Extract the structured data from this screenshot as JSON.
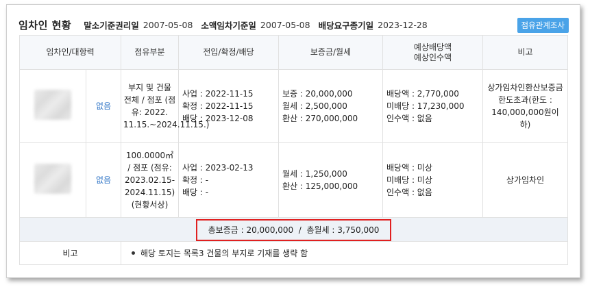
{
  "header": {
    "title": "임차인 현황",
    "items": [
      {
        "label": "말소기준권리일",
        "value": "2007-05-08"
      },
      {
        "label": "소액임차기준일",
        "value": "2007-05-08"
      },
      {
        "label": "배당요구종기일",
        "value": "2023-12-28"
      }
    ],
    "button_label": "점유관계조사"
  },
  "table": {
    "columns": [
      "임차인/대항력",
      "점유부분",
      "전입/확정/배당",
      "보증금/월세",
      "예상배당액\n예상인수액",
      "비고"
    ],
    "rows": [
      {
        "opposing": "없음",
        "occupancy": "부지 및 건물 전체 / 점포 (점유: 2022. 11.15.~2024.11.15.)",
        "dates": [
          "사업 : 2022-11-15",
          "확정 : 2022-11-15",
          "배당 : 2023-12-08"
        ],
        "deposit": [
          "보증 : 20,000,000",
          "월세 : 2,500,000",
          "환산 : 270,000,000"
        ],
        "expected": [
          "배당액 : 2,770,000",
          "미배당 : 17,230,000",
          "인수액 : 없음"
        ],
        "remark": "상가임차인환산보증금 한도초과(한도 : 140,000,000원이하)"
      },
      {
        "opposing": "없음",
        "occupancy": "100.0000㎡ / 점포 (점유: 2023.02.15-2024.11.15) (현황서상)",
        "dates": [
          "사업 : 2023-02-13",
          "확정 : -",
          "배당 : -"
        ],
        "deposit": [
          "월세 : 1,250,000",
          "환산 : 125,000,000"
        ],
        "expected": [
          "배당액 : 미상",
          "미배당 : 미상",
          "인수액 : 없음"
        ],
        "remark": "상가임차인"
      }
    ],
    "summary": "총보증금 : 20,000,000  /  총월세 : 3,750,000",
    "note_label": "비고",
    "note_text": "해당 토지는 목록3 건물의 부지로 기재를 생략 함"
  },
  "colors": {
    "accent_button": "#4aa3e8",
    "highlight_border": "#e02020",
    "link": "#2f74c6"
  }
}
